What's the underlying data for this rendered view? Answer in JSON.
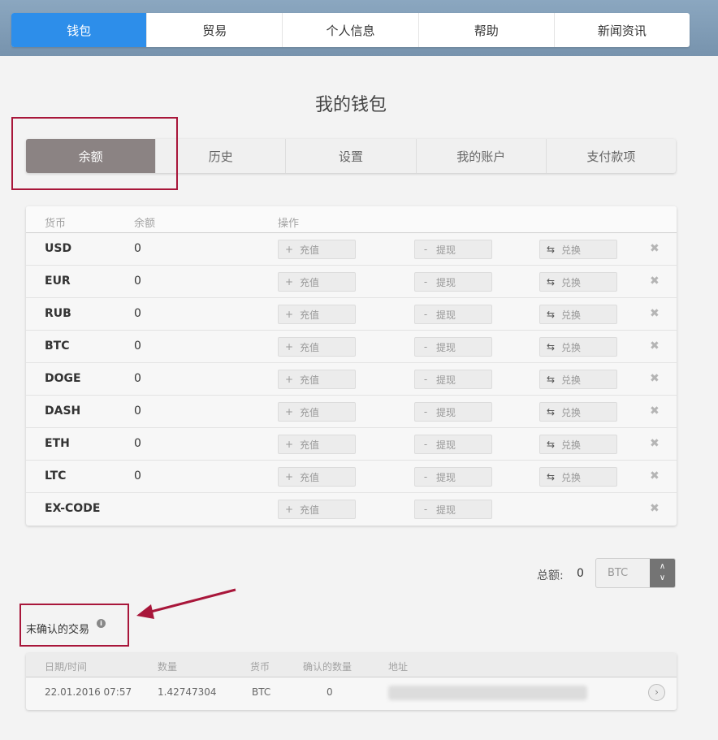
{
  "topnav": {
    "items": [
      {
        "label": "钱包",
        "active": true
      },
      {
        "label": "贸易",
        "active": false
      },
      {
        "label": "个人信息",
        "active": false
      },
      {
        "label": "帮助",
        "active": false
      },
      {
        "label": "新闻资讯",
        "active": false
      }
    ]
  },
  "page": {
    "title": "我的钱包"
  },
  "subtabs": [
    {
      "label": "余额",
      "active": true
    },
    {
      "label": "历史",
      "active": false
    },
    {
      "label": "设置",
      "active": false
    },
    {
      "label": "我的账户",
      "active": false
    },
    {
      "label": "支付款项",
      "active": false
    }
  ],
  "balance_table": {
    "headers": {
      "currency": "货币",
      "balance": "余额",
      "actions": "操作"
    },
    "deposit_label": "充值",
    "withdraw_label": "提现",
    "exchange_label": "兑换",
    "rows": [
      {
        "currency": "USD",
        "balance": "0",
        "exchange": true
      },
      {
        "currency": "EUR",
        "balance": "0",
        "exchange": true
      },
      {
        "currency": "RUB",
        "balance": "0",
        "exchange": true
      },
      {
        "currency": "BTC",
        "balance": "0",
        "exchange": true
      },
      {
        "currency": "DOGE",
        "balance": "0",
        "exchange": true
      },
      {
        "currency": "DASH",
        "balance": "0",
        "exchange": true
      },
      {
        "currency": "ETH",
        "balance": "0",
        "exchange": true
      },
      {
        "currency": "LTC",
        "balance": "0",
        "exchange": true
      },
      {
        "currency": "EX-CODE",
        "balance": "",
        "exchange": false
      }
    ]
  },
  "total": {
    "label": "总额:",
    "value": "0",
    "currency": "BTC"
  },
  "unconfirmed": {
    "title": "末确认的交易",
    "headers": {
      "datetime": "日期/时间",
      "amount": "数量",
      "currency": "货币",
      "confirmations": "确认的数量",
      "address": "地址"
    },
    "rows": [
      {
        "datetime": "22.01.2016 07:57",
        "amount": "1.42747304",
        "currency": "BTC",
        "confirmations": "0"
      }
    ]
  },
  "colors": {
    "active_nav": "#2d8eea",
    "active_subtab": "#8b8383",
    "annotation": "#a8163a"
  },
  "icons": {
    "deposit": "plus-icon",
    "withdraw": "minus-icon",
    "exchange": "swap-arrows-icon",
    "remove": "close-x-icon",
    "info": "info-icon",
    "go": "chevron-right-circle-icon"
  }
}
